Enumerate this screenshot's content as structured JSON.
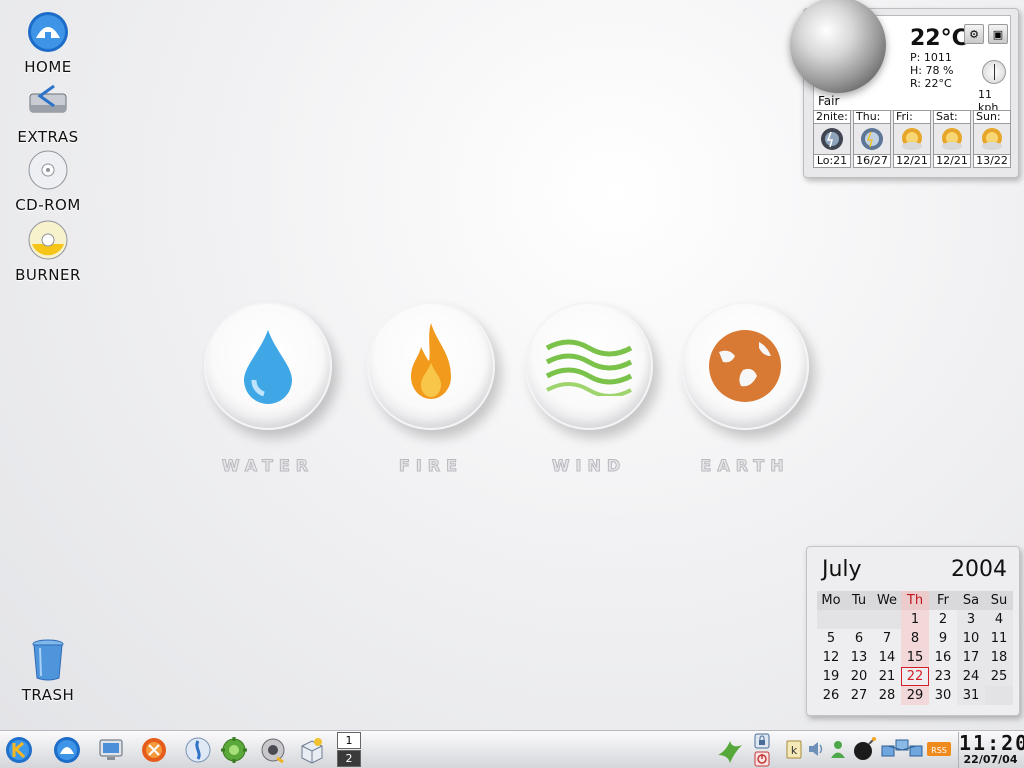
{
  "desktop": {
    "icons": [
      {
        "label": "HOME",
        "icon": "home-folder-icon"
      },
      {
        "label": "EXTRAS",
        "icon": "drive-icon"
      },
      {
        "label": "CD-ROM",
        "icon": "cdrom-icon"
      },
      {
        "label": "BURNER",
        "icon": "cd-burner-icon"
      },
      {
        "label": "TRASH",
        "icon": "trash-icon"
      }
    ],
    "emblems": [
      {
        "caption": "WATER",
        "icon": "water-drop-icon",
        "color": "#3fa7e6"
      },
      {
        "caption": "FIRE",
        "icon": "flame-icon",
        "color": "#f29a1c"
      },
      {
        "caption": "WIND",
        "icon": "wind-waves-icon",
        "color": "#7bc24a"
      },
      {
        "caption": "EARTH",
        "icon": "globe-icon",
        "color": "#d87a34"
      }
    ]
  },
  "weather": {
    "temperature": "22°C",
    "pressure": "P: 1011",
    "humidity": "H: 78 %",
    "real_feel": "R: 22°C",
    "wind": "11 kph",
    "condition": "Fair",
    "forecast": [
      {
        "day": "2nite:",
        "value": "Lo:21",
        "icon": "storm-night-icon"
      },
      {
        "day": "Thu:",
        "value": "16/27",
        "icon": "storm-day-icon"
      },
      {
        "day": "Fri:",
        "value": "12/21",
        "icon": "sun-cloud-icon"
      },
      {
        "day": "Sat:",
        "value": "12/21",
        "icon": "sun-cloud-icon"
      },
      {
        "day": "Sun:",
        "value": "13/22",
        "icon": "sun-cloud-icon"
      }
    ]
  },
  "calendar": {
    "month": "July",
    "year": "2004",
    "weekdays": [
      "Mo",
      "Tu",
      "We",
      "Th",
      "Fr",
      "Sa",
      "Su"
    ],
    "weeks": [
      [
        "",
        "",
        "",
        "1",
        "2",
        "3",
        "4"
      ],
      [
        "5",
        "6",
        "7",
        "8",
        "9",
        "10",
        "11"
      ],
      [
        "12",
        "13",
        "14",
        "15",
        "16",
        "17",
        "18"
      ],
      [
        "19",
        "20",
        "21",
        "22",
        "23",
        "24",
        "25"
      ],
      [
        "26",
        "27",
        "28",
        "29",
        "30",
        "31",
        ""
      ]
    ],
    "today": "22",
    "today_color": "#d31f26"
  },
  "taskbar": {
    "launchers": [
      "kde-menu-icon",
      "home-icon",
      "monitor-icon",
      "mozilla-icon",
      "konqueror-icon",
      "settings-gear-icon",
      "speaker-icon",
      "package-icon"
    ],
    "pager": [
      "1",
      "2"
    ],
    "active_desktop": "1",
    "tray": [
      "bird-icon",
      "lock-icon",
      "logout-icon",
      "klipper-icon",
      "volume-icon",
      "user-icon",
      "bomb-icon",
      "network-icon",
      "rss-icon"
    ],
    "clock_time": "11:20",
    "clock_date": "22/07/04"
  }
}
